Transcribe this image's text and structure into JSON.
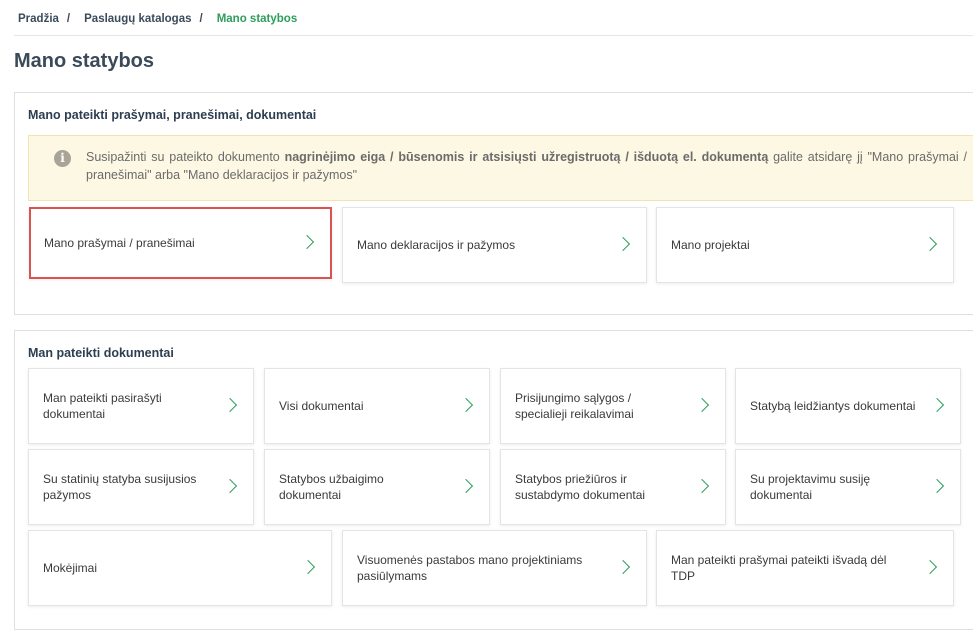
{
  "breadcrumb": {
    "items": [
      "Pradžia",
      "Paslaugų katalogas",
      "Mano statybos"
    ],
    "separator": "/"
  },
  "page_title": "Mano statybos",
  "section1": {
    "title": "Mano pateikti prašymai, pranešimai, dokumentai",
    "alert": {
      "icon": "info-icon",
      "text_before": "Susipažinti su pateikto dokumento ",
      "text_bold": "nagrinėjimo eiga / būsenomis ir atsisiųsti užregistruotą / išduotą el. dokumentą",
      "text_after": " galite atsidarę jį \"Mano prašymai / pranešimai\" arba \"Mano deklaracijos ir pažymos\""
    },
    "cards": [
      {
        "label": "Mano prašymai / pranešimai",
        "selected": true
      },
      {
        "label": "Mano deklaracijos ir pažymos"
      },
      {
        "label": "Mano projektai"
      }
    ]
  },
  "section2": {
    "title": "Man pateikti dokumentai",
    "cards": [
      {
        "label": "Man pateikti pasirašyti dokumentai"
      },
      {
        "label": "Visi dokumentai"
      },
      {
        "label": "Prisijungimo sąlygos / specialieji reikalavimai"
      },
      {
        "label": "Statybą leidžiantys dokumentai"
      },
      {
        "label": "Su statinių statyba susijusios pažymos"
      },
      {
        "label": "Statybos užbaigimo dokumentai"
      },
      {
        "label": "Statybos priežiūros ir sustabdymo dokumentai"
      },
      {
        "label": "Su projektavimu susiję dokumentai"
      },
      {
        "label": "Mokėjimai"
      },
      {
        "label": "Visuomenės pastabos mano projektiniams pasiūlymams"
      },
      {
        "label": "Man pateikti prašymai pateikti išvadą dėl TDP"
      }
    ]
  },
  "colors": {
    "accent": "#2e9e5b",
    "selected_border": "#d9534f",
    "alert_bg": "#fdf8e4"
  }
}
